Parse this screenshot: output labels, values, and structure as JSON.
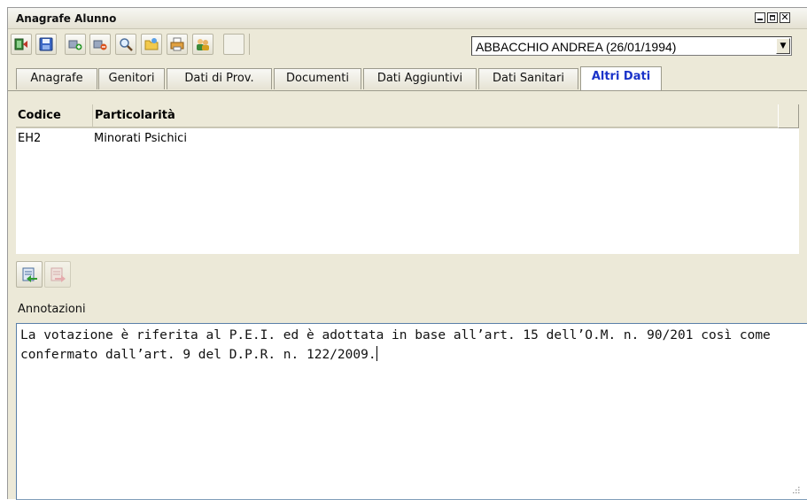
{
  "window": {
    "title": "Anagrafe Alunno"
  },
  "toolbar": {
    "buttons": [
      {
        "icon": "exit-icon"
      },
      {
        "icon": "save-icon"
      },
      {
        "icon": "add-record-icon"
      },
      {
        "icon": "delete-record-icon"
      },
      {
        "icon": "search-icon"
      },
      {
        "icon": "open-folder-icon"
      },
      {
        "icon": "print-icon"
      },
      {
        "icon": "users-icon"
      }
    ],
    "student_select": {
      "selected": "ABBACCHIO ANDREA (26/01/1994)"
    }
  },
  "tabs": [
    {
      "label": "Anagrafe",
      "active": false
    },
    {
      "label": "Genitori",
      "active": false
    },
    {
      "label": "Dati di Prov.",
      "active": false
    },
    {
      "label": "Documenti",
      "active": false
    },
    {
      "label": "Dati Aggiuntivi",
      "active": false
    },
    {
      "label": "Dati Sanitari",
      "active": false
    },
    {
      "label": "Altri Dati",
      "active": true
    }
  ],
  "table": {
    "columns": [
      "Codice",
      "Particolarità"
    ],
    "rows": [
      {
        "codice": "EH2",
        "particolarita": "Minorati Psichici"
      }
    ]
  },
  "actions": {
    "add_icon": "add-row-icon",
    "remove_icon": "remove-row-icon"
  },
  "annotazioni": {
    "label": "Annotazioni",
    "text": "La votazione è riferita al P.E.I. ed è adottata in base all’art. 15 dell’O.M. n. 90/201 così come confermato dall’art. 9 del D.P.R. n. 122/2009."
  },
  "colors": {
    "window_bg": "#ece9d8",
    "active_tab_text": "#1a33c9",
    "textarea_border": "#7f9db9"
  }
}
